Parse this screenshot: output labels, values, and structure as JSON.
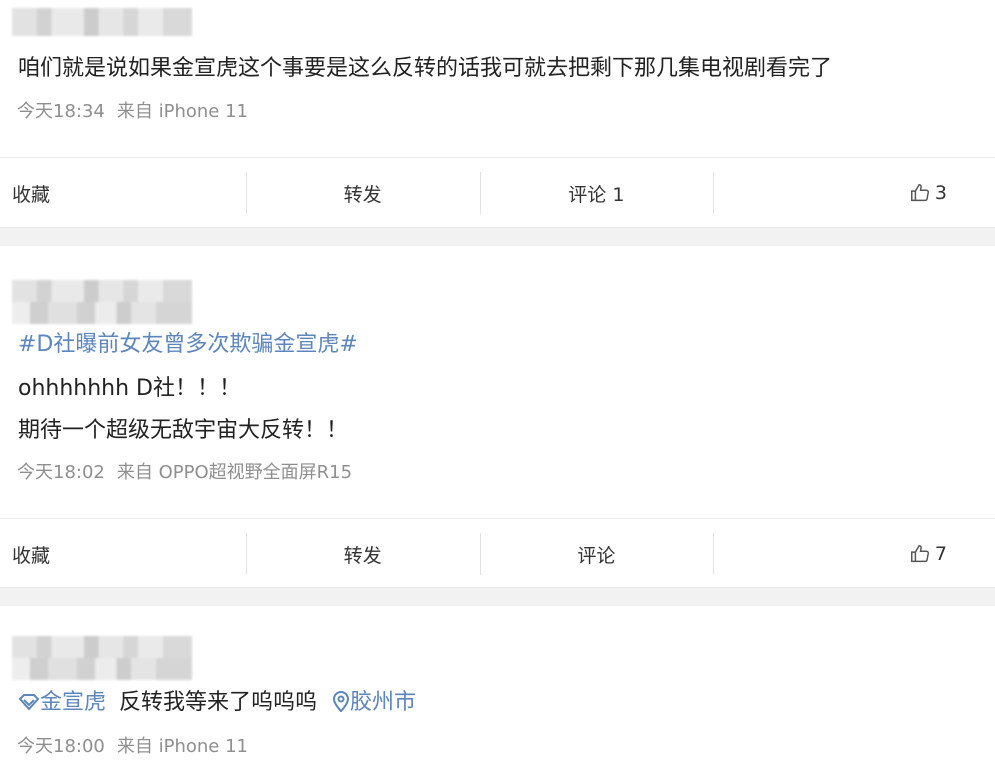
{
  "posts": [
    {
      "text": "咱们就是说如果金宣虎这个事要是这么反转的话我可就去把剩下那几集电视剧看完了",
      "time": "今天18:34",
      "source": "来自 iPhone 11",
      "actions": {
        "favorite": "收藏",
        "repost": "转发",
        "comment": "评论 1",
        "like_count": "3"
      }
    },
    {
      "topic": "#D社曝前女友曾多次欺骗金宣虎#",
      "line1": "ohhhhhhh D社！！！",
      "line2": "期待一个超级无敌宇宙大反转！！",
      "time": "今天18:02",
      "source": "来自 OPPO超视野全面屏R15",
      "actions": {
        "favorite": "收藏",
        "repost": "转发",
        "comment": "评论",
        "like_count": "7"
      }
    },
    {
      "tag": "金宣虎",
      "text": "反转我等来了呜呜呜",
      "location": "胶州市",
      "time": "今天18:00",
      "source": "来自 iPhone 11"
    }
  ],
  "icons": {
    "like": "thumbs-up-icon",
    "super_topic": "diamond-topic-icon",
    "location": "location-pin-icon"
  },
  "colors": {
    "link": "#5d86bd",
    "meta": "#8f8f8f",
    "divider": "#f2f2f2"
  }
}
